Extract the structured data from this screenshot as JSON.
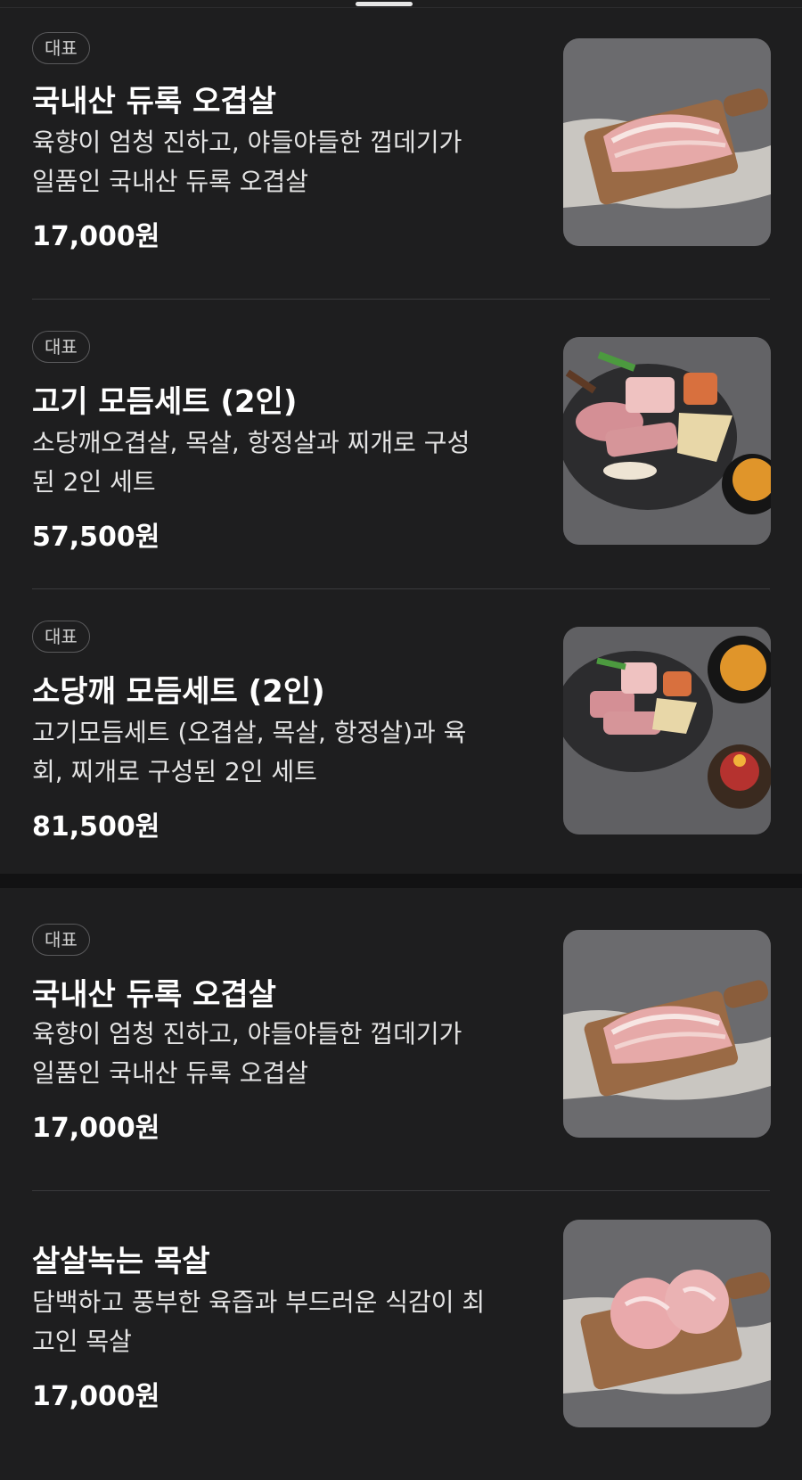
{
  "menu_groups": [
    {
      "items": [
        {
          "badge": "대표",
          "name": "국내산 듀록 오겹살",
          "desc_line1": "육향이 엄청 진하고, 야들야들한 껍데기가",
          "desc_line2": "일품인 국내산 듀록 오겹살",
          "price": "17,000원",
          "image": "pork-belly-board-photo"
        },
        {
          "badge": "대표",
          "name": "고기 모듬세트 (2인)",
          "desc_line1": "소당깨오겹살, 목살, 항정살과 찌개로 구성",
          "desc_line2": "된 2인 세트",
          "price": "57,500원",
          "image": "meat-platter-stew-photo"
        },
        {
          "badge": "대표",
          "name": "소당깨 모듬세트 (2인)",
          "desc_line1": "고기모듬세트 (오겹살, 목살, 항정살)과 육",
          "desc_line2": "회, 찌개로 구성된 2인 세트",
          "price": "81,500원",
          "image": "meat-platter-yukhoe-photo"
        }
      ]
    },
    {
      "items": [
        {
          "badge": "대표",
          "name": "국내산 듀록 오겹살",
          "desc_line1": "육향이 엄청 진하고, 야들야들한 껍데기가",
          "desc_line2": "일품인 국내산 듀록 오겹살",
          "price": "17,000원",
          "image": "pork-belly-board-photo"
        },
        {
          "badge": "",
          "name": "살살녹는 목살",
          "desc_line1": "담백하고 풍부한 육즙과 부드러운 식감이 최",
          "desc_line2": "고인 목살",
          "price": "17,000원",
          "image": "pork-neck-board-photo"
        }
      ]
    }
  ],
  "colors": {
    "background": "#1e1e1f",
    "text": "#ffffff",
    "divider": "#3a3a3c",
    "badge_border": "#5a5a5c"
  }
}
